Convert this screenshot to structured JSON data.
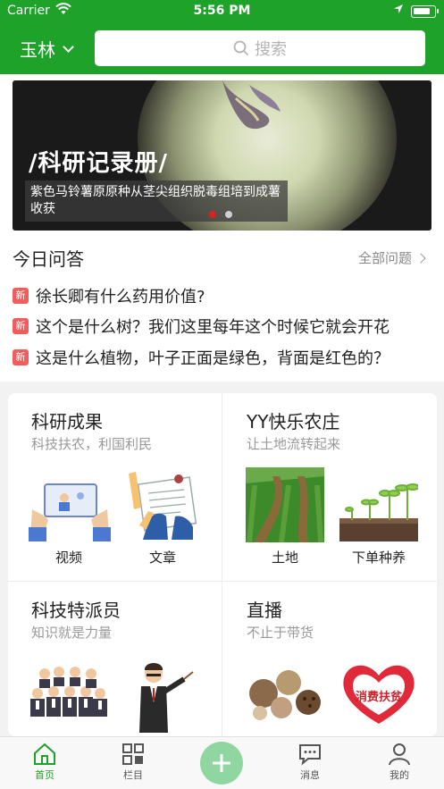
{
  "status_bar": {
    "carrier": "Carrier",
    "time": "5:56 PM"
  },
  "nav": {
    "city": "玉林",
    "search_placeholder": "搜索"
  },
  "banner": {
    "tag": "/科研记录册/",
    "caption": "紫色马铃薯原原种从茎尖组织脱毒组培到成薯收获",
    "slide_count": 2,
    "active_slide": 1
  },
  "qa": {
    "title": "今日问答",
    "all_link": "全部问题",
    "badge": "新",
    "items": [
      "徐长卿有什么药用价值?",
      "这个是什么树？我们这里每年这个时候它就会开花",
      "这是什么植物，叶子正面是绿色，背面是红色的？"
    ]
  },
  "cards": {
    "research": {
      "title": "科研成果",
      "subtitle": "科技扶农，利国利民",
      "items": [
        "视频",
        "文章"
      ]
    },
    "farm": {
      "title": "YY快乐农庄",
      "subtitle": "让土地流转起来",
      "items": [
        "土地",
        "下单种养"
      ]
    },
    "envoy": {
      "title": "科技特派员",
      "subtitle": "知识就是力量"
    },
    "live": {
      "title": "直播",
      "subtitle": "不止于带货",
      "poverty_text": "消费扶贫"
    }
  },
  "tabbar": {
    "items": [
      "首页",
      "栏目",
      "消息",
      "我的"
    ],
    "active": "首页"
  },
  "colors": {
    "brand_green": "#1fa22a",
    "badge_red": "#f25c5c",
    "plus_green": "#8fd6a0"
  }
}
